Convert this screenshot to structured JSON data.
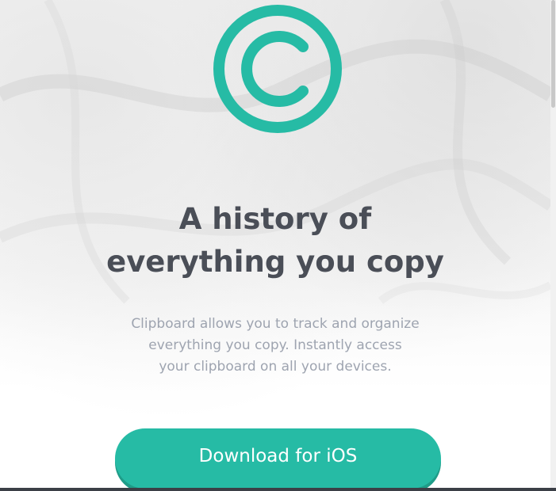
{
  "hero": {
    "logo_icon": "copyright-c-icon",
    "accent_color": "#26bba5",
    "headline_lines": [
      "A history of",
      "everything you copy"
    ],
    "description_lines": [
      "Clipboard allows you to track and organize",
      "everything you copy. Instantly access",
      "your clipboard on all your devices."
    ],
    "cta_label": "Download for iOS"
  }
}
